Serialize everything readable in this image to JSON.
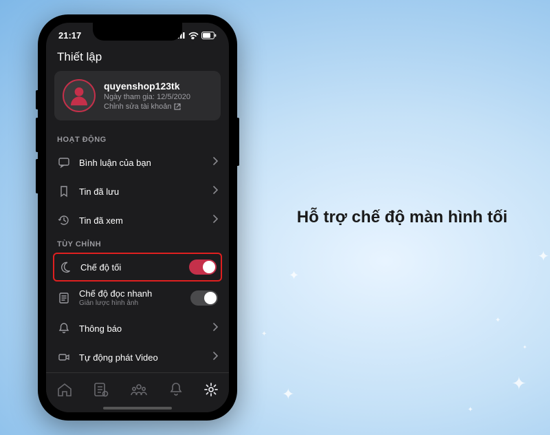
{
  "statusbar": {
    "time": "21:17"
  },
  "header": {
    "title": "Thiết lập"
  },
  "profile": {
    "username": "quyenshop123tk",
    "joined_label": "Ngày tham gia: 12/5/2020",
    "edit_label": "Chỉnh sửa tài khoản"
  },
  "sections": {
    "activity": {
      "title": "HOẠT ĐỘNG",
      "comments": "Bình luận của bạn",
      "saved": "Tin đã lưu",
      "viewed": "Tin đã xem"
    },
    "customize": {
      "title": "TÙY CHỈNH",
      "dark_mode": "Chế độ tối",
      "quick_read": "Chế độ đọc nhanh",
      "quick_read_sub": "Giản lược hình ảnh",
      "notifications": "Thông báo",
      "autoplay": "Tự động phát Video"
    }
  },
  "headline": "Hỗ trợ chế độ màn hình tối",
  "colors": {
    "accent": "#c5304a",
    "highlight": "#e02020"
  }
}
